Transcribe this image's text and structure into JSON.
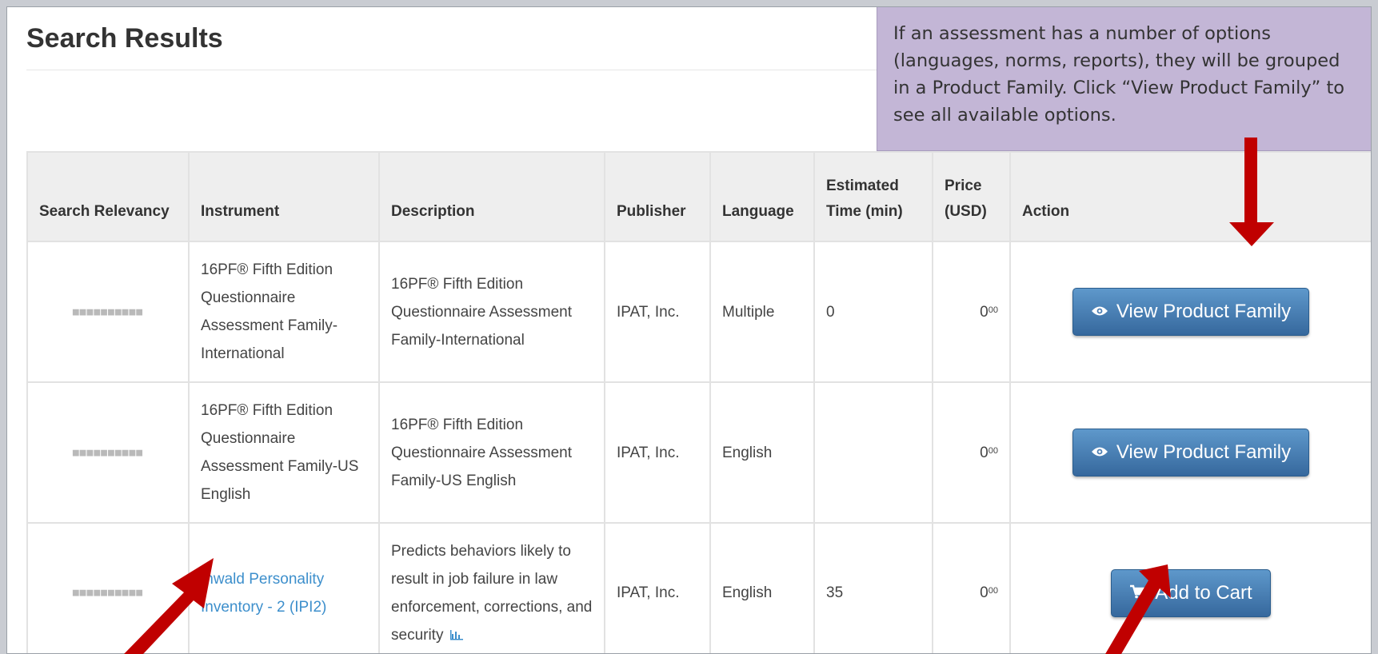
{
  "page": {
    "title": "Search Results"
  },
  "callout": {
    "text": "If an assessment has a number of options (languages, norms, reports), they will be grouped in a Product Family. Click “View Product Family” to see all available options."
  },
  "table": {
    "columns": [
      "Search Relevancy",
      "Instrument",
      "Description",
      "Publisher",
      "Language",
      "Estimated Time (min)",
      "Price (USD)",
      "Action"
    ],
    "rows": [
      {
        "relevancy": "■■■■■■■■■■",
        "instrument": "16PF® Fifth Edition Questionnaire Assessment Family-International",
        "description": "16PF® Fifth Edition Questionnaire Assessment Family-International",
        "publisher": "IPAT, Inc.",
        "language": "Multiple",
        "time": "0",
        "price_main": "0",
        "price_sup": "00",
        "action": "View Product Family"
      },
      {
        "relevancy": "■■■■■■■■■■",
        "instrument": "16PF® Fifth Edition Questionnaire Assessment Family-US English",
        "description": "16PF® Fifth Edition Questionnaire Assessment Family-US English",
        "publisher": "IPAT, Inc.",
        "language": "English",
        "time": "",
        "price_main": "0",
        "price_sup": "00",
        "action": "View Product Family"
      },
      {
        "relevancy": "■■■■■■■■■■",
        "instrument": "Inwald Personality Inventory - 2 (IPI2)",
        "description": "Predicts behaviors likely to result in job failure in law enforcement, corrections, and security",
        "publisher": "IPAT, Inc.",
        "language": "English",
        "time": "35",
        "price_main": "0",
        "price_sup": "00",
        "action": "Add to Cart"
      }
    ]
  },
  "icons": {
    "view": "eye-icon",
    "cart": "cart-icon",
    "report": "bar-chart-icon"
  },
  "colors": {
    "callout_bg": "#c3b6d6",
    "button": "#4a7db3",
    "link": "#3d8fcc",
    "arrow": "#c00000"
  }
}
